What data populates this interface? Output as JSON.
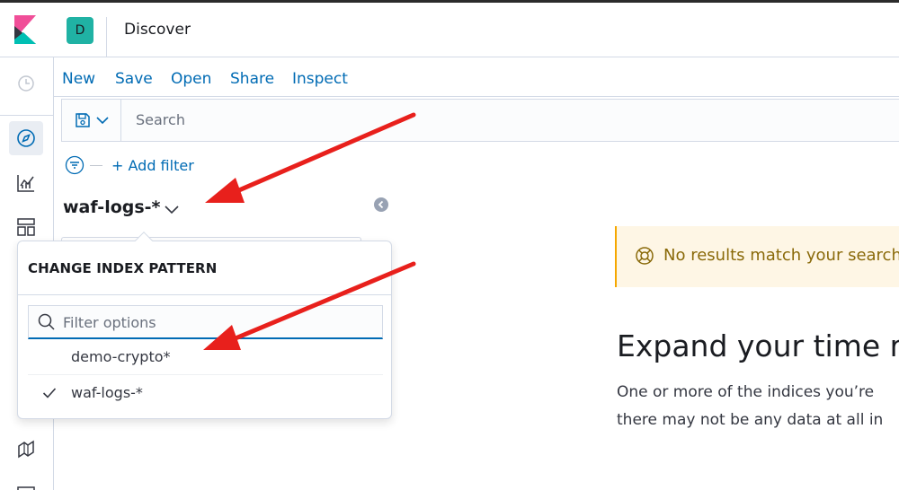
{
  "header": {
    "space_initial": "D",
    "app_title": "Discover"
  },
  "sidebar": {
    "icons": [
      "recently-viewed-icon",
      "discover-icon",
      "visualize-icon",
      "dashboard-icon",
      "canvas-icon",
      "maps-icon"
    ]
  },
  "topnav": {
    "items": [
      "New",
      "Save",
      "Open",
      "Share",
      "Inspect"
    ]
  },
  "query": {
    "search_placeholder": "Search"
  },
  "filters": {
    "add_filter_label": "+ Add filter"
  },
  "index_pattern": {
    "current": "waf-logs-*"
  },
  "popover": {
    "title": "CHANGE INDEX PATTERN",
    "filter_placeholder": "Filter options",
    "options": [
      {
        "label": "demo-crypto*",
        "checked": false
      },
      {
        "label": "waf-logs-*",
        "checked": true
      }
    ]
  },
  "results": {
    "callout_text": "No results match your search",
    "expand_title": "Expand your time ran",
    "body_line1": "One or more of the indices you’re",
    "body_line2": "there may not be any data at all in"
  },
  "colors": {
    "link": "#006bb4",
    "teal_avatar": "#20b2a4",
    "annotation_arrow": "#e8201c",
    "callout_bg": "#fef6e5",
    "callout_border": "#f5a700"
  }
}
